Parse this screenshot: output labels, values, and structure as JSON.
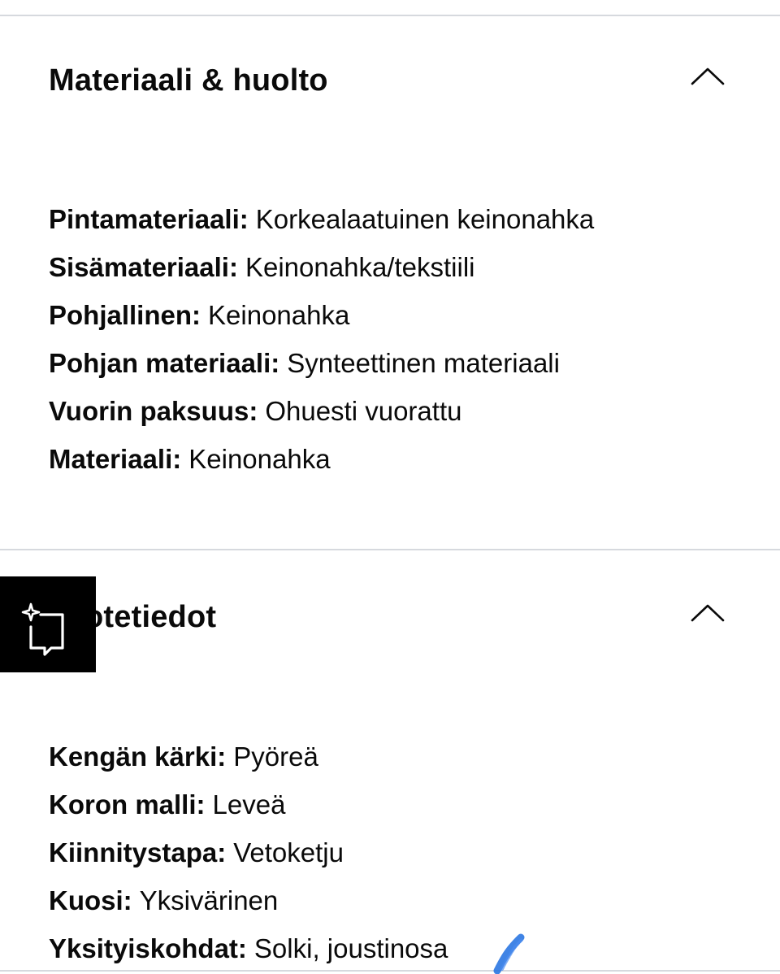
{
  "sections": [
    {
      "title": "Materiaali & huolto",
      "expanded": true,
      "toggle_icon": "chevron-up-icon",
      "attributes": [
        {
          "key": "Pintamateriaali",
          "value": "Korkealaatuinen keinonahka"
        },
        {
          "key": "Sisämateriaali",
          "value": "Keinonahka/tekstiili"
        },
        {
          "key": "Pohjallinen",
          "value": "Keinonahka"
        },
        {
          "key": "Pohjan materiaali",
          "value": "Synteettinen materiaali"
        },
        {
          "key": "Vuorin paksuus",
          "value": "Ohuesti vuorattu"
        },
        {
          "key": "Materiaali",
          "value": "Keinonahka"
        }
      ]
    },
    {
      "title": "Tuotetiedot",
      "expanded": true,
      "toggle_icon": "chevron-up-icon",
      "attributes": [
        {
          "key": "Kengän kärki",
          "value": "Pyöreä"
        },
        {
          "key": "Koron malli",
          "value": "Leveä"
        },
        {
          "key": "Kiinnitystapa",
          "value": "Vetoketju"
        },
        {
          "key": "Kuosi",
          "value": "Yksivärinen"
        },
        {
          "key": "Yksityiskohdat",
          "value": "Solki, joustinosa"
        }
      ]
    }
  ],
  "floating_button": {
    "icon": "sparkle-chat-icon",
    "background": "#000000",
    "icon_color": "#ffffff"
  },
  "colors": {
    "text": "#0a0a0a",
    "divider": "#d6d9de",
    "pen_mark": "#1f6fe0"
  }
}
